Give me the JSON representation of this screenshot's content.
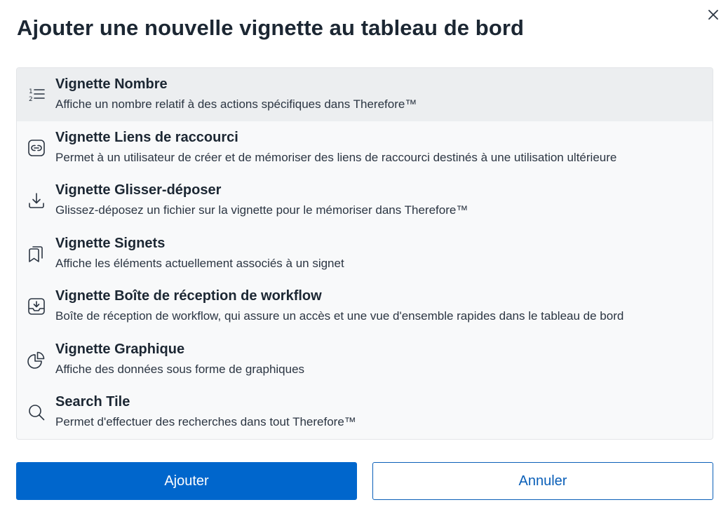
{
  "dialog": {
    "title": "Ajouter une nouvelle vignette au tableau de bord",
    "close_icon": "close-icon"
  },
  "tiles": [
    {
      "title": "Vignette Nombre",
      "description": "Affiche un nombre relatif à des actions spécifiques dans Therefore™",
      "icon": "numbered-list-icon",
      "selected": true
    },
    {
      "title": "Vignette Liens de raccourci",
      "description": "Permet à un utilisateur de créer et de mémoriser des liens de raccourci destinés à une utilisation ultérieure",
      "icon": "link-icon",
      "selected": false
    },
    {
      "title": "Vignette Glisser-déposer",
      "description": "Glissez-déposez un fichier sur la vignette pour le mémoriser dans Therefore™",
      "icon": "download-icon",
      "selected": false
    },
    {
      "title": "Vignette Signets",
      "description": "Affiche les éléments actuellement associés à un signet",
      "icon": "bookmarks-icon",
      "selected": false
    },
    {
      "title": "Vignette Boîte de réception de workflow",
      "description": "Boîte de réception de workflow, qui assure un accès et une vue d'ensemble rapides dans le tableau de bord",
      "icon": "inbox-icon",
      "selected": false
    },
    {
      "title": "Vignette Graphique",
      "description": "Affiche des données sous forme de graphiques",
      "icon": "pie-chart-icon",
      "selected": false
    },
    {
      "title": "Search Tile",
      "description": "Permet d'effectuer des recherches dans tout Therefore™",
      "icon": "search-icon",
      "selected": false
    }
  ],
  "buttons": {
    "add_label": "Ajouter",
    "cancel_label": "Annuler"
  },
  "colors": {
    "primary": "#0066cc",
    "selected_row": "#eceef0",
    "list_background": "#f8f9fa",
    "text": "#1c2733"
  }
}
